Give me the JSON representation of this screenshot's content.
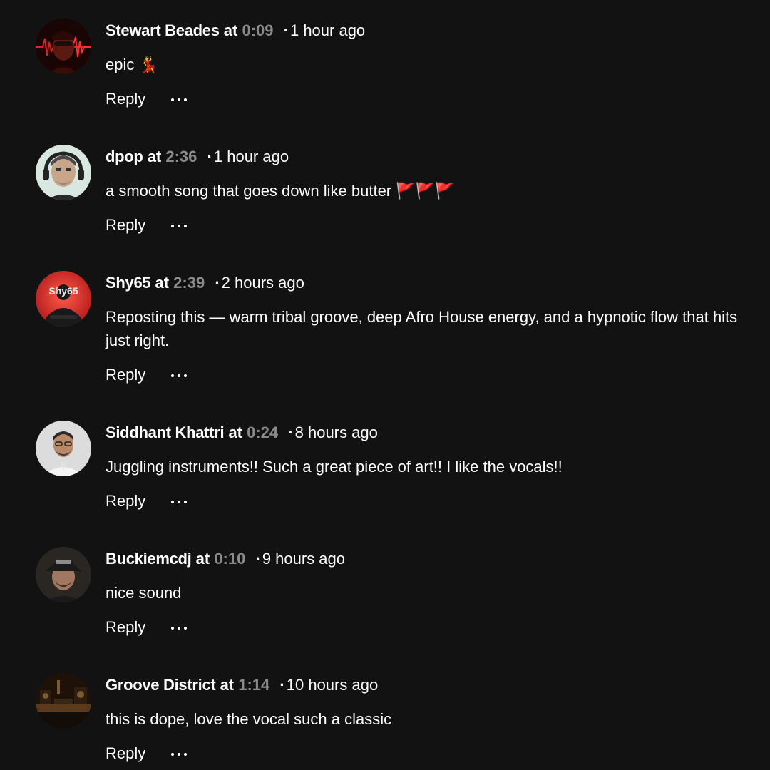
{
  "comments": [
    {
      "author": "Stewart Beades",
      "at": "at",
      "timestamp": "0:09",
      "ago": "1 hour ago",
      "text": "epic 💃",
      "reply": "Reply",
      "avatar": "red-waveform-portrait"
    },
    {
      "author": "dpop",
      "at": "at",
      "timestamp": "2:36",
      "ago": "1 hour ago",
      "text": "a smooth song that goes down like butter 🚩🚩🚩",
      "reply": "Reply",
      "avatar": "man-with-headphones-portrait"
    },
    {
      "author": "Shy65",
      "at": "at",
      "timestamp": "2:39",
      "ago": "2 hours ago",
      "text": "Reposting this — warm tribal groove, deep Afro House energy, and a hypnotic flow that hits just right.",
      "reply": "Reply",
      "avatar": "shy65-logo-portrait",
      "avatar_text": "Shy65"
    },
    {
      "author": "Siddhant Khattri",
      "at": "at",
      "timestamp": "0:24",
      "ago": "8 hours ago",
      "text": "Juggling instruments!! Such a great piece of art!! I like the vocals!!",
      "reply": "Reply",
      "avatar": "man-with-glasses-portrait"
    },
    {
      "author": "Buckiemcdj",
      "at": "at",
      "timestamp": "0:10",
      "ago": "9 hours ago",
      "text": "nice sound",
      "reply": "Reply",
      "avatar": "man-with-cap-portrait"
    },
    {
      "author": "Groove District",
      "at": "at",
      "timestamp": "1:14",
      "ago": "10 hours ago",
      "text": "this is dope, love the vocal such a classic",
      "reply": "Reply",
      "avatar": "studio-desk-photo"
    }
  ],
  "colors": {
    "background": "#121212",
    "text": "#ffffff",
    "timestamp": "#8a8a8a"
  },
  "icons": {
    "more": "more-horizontal-icon"
  }
}
